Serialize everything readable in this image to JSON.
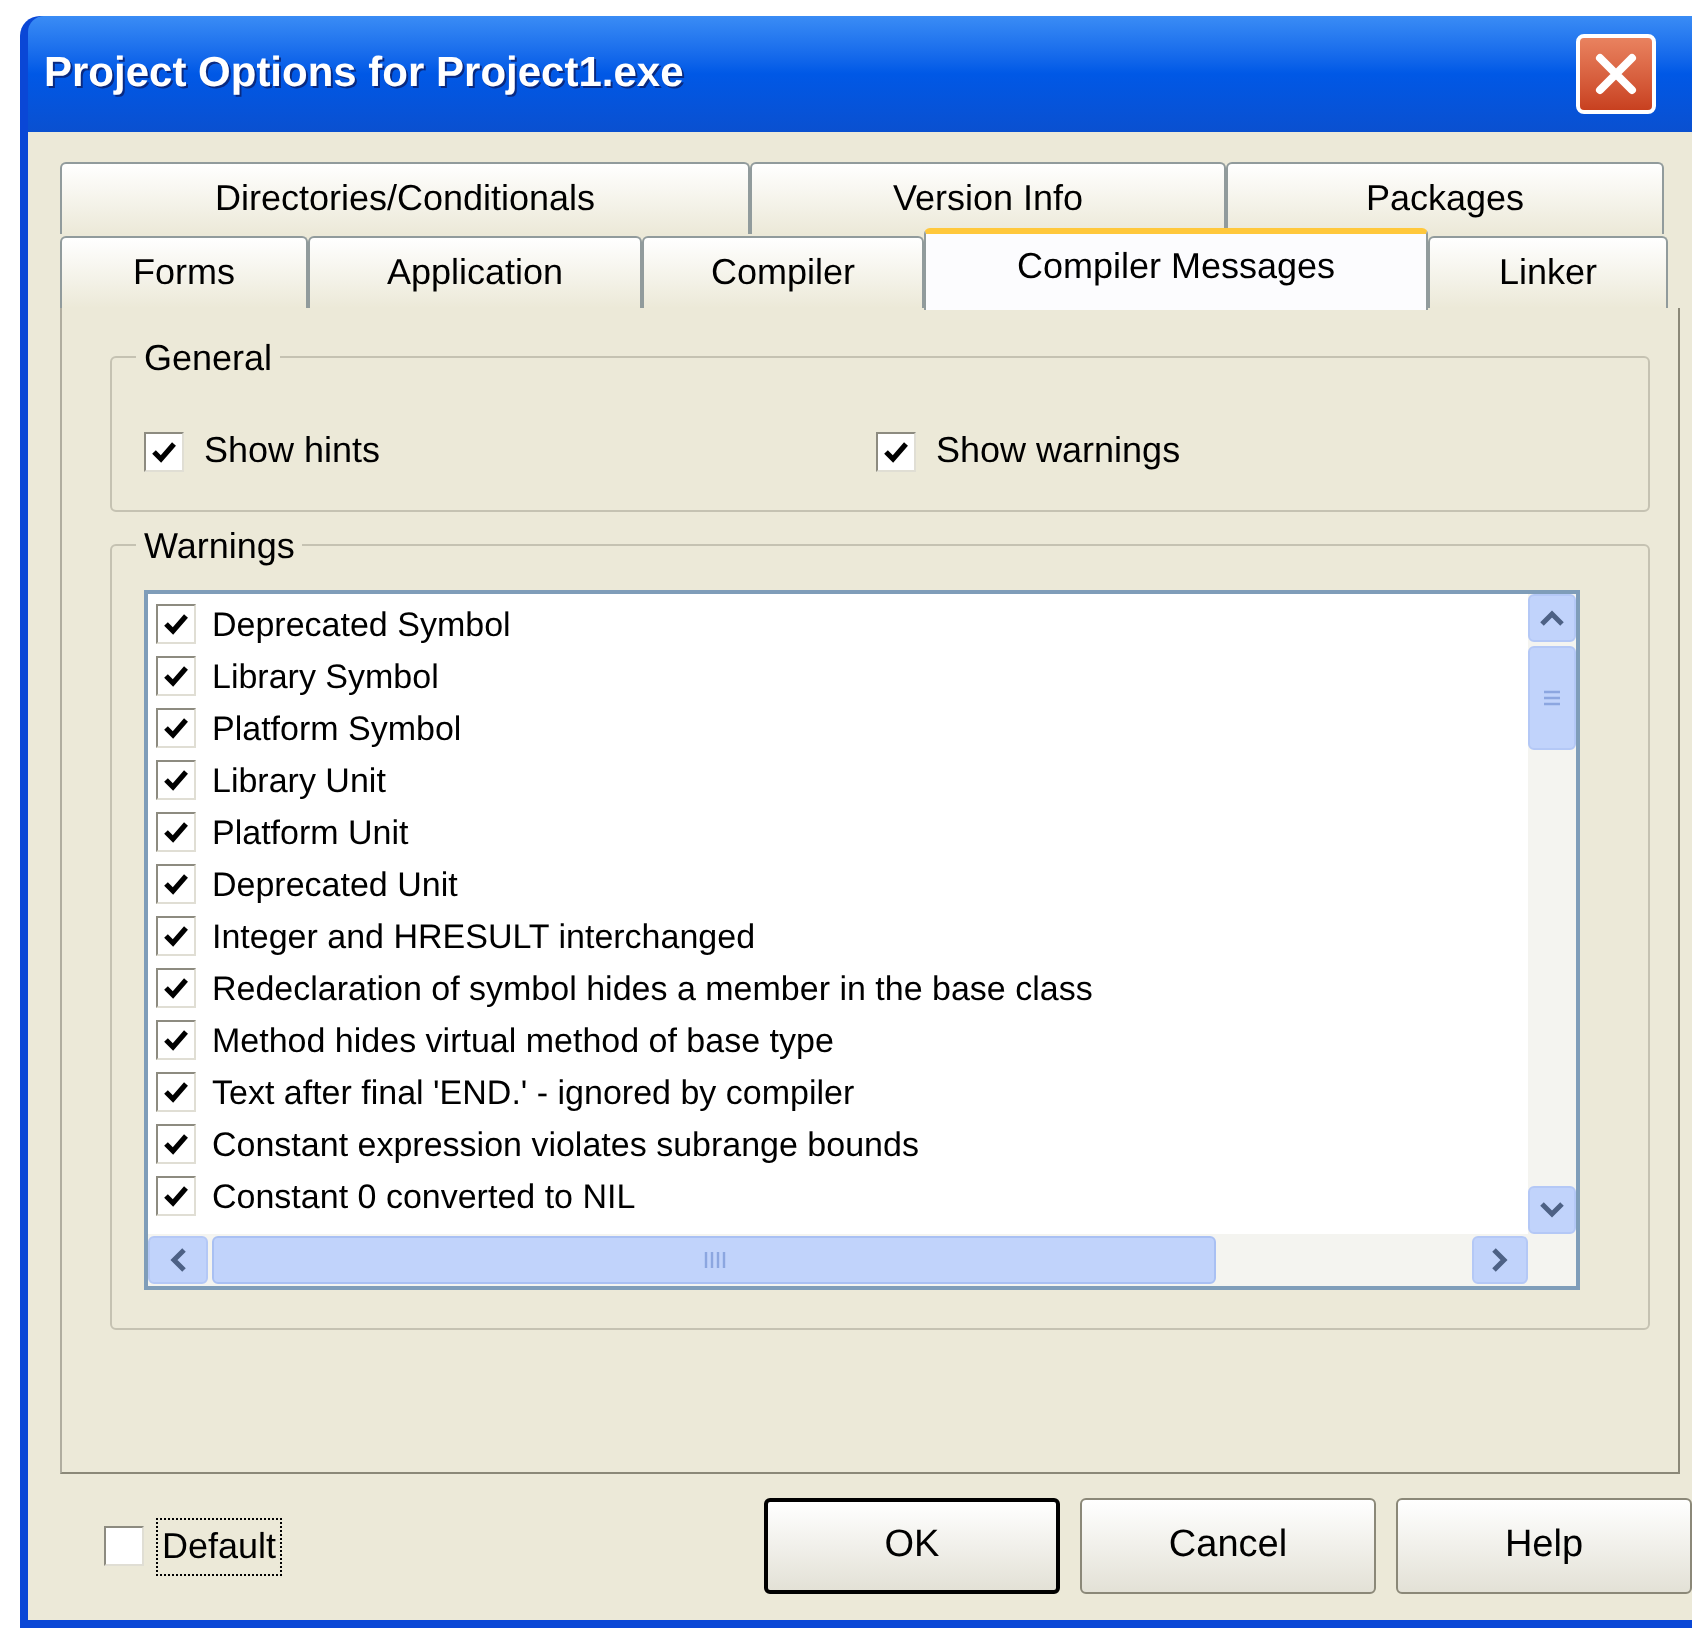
{
  "window": {
    "title": "Project Options for Project1.exe"
  },
  "tab_rows": [
    {
      "tabs": [
        {
          "label": "Directories/Conditionals",
          "selected": false
        },
        {
          "label": "Version Info",
          "selected": false
        },
        {
          "label": "Packages",
          "selected": false
        }
      ]
    },
    {
      "tabs": [
        {
          "label": "Forms",
          "selected": false
        },
        {
          "label": "Application",
          "selected": false
        },
        {
          "label": "Compiler",
          "selected": false
        },
        {
          "label": "Compiler Messages",
          "selected": true
        },
        {
          "label": "Linker",
          "selected": false
        }
      ]
    }
  ],
  "general": {
    "title": "General",
    "checkboxes": [
      {
        "label": "Show hints",
        "checked": true
      },
      {
        "label": "Show warnings",
        "checked": true
      }
    ]
  },
  "warnings": {
    "title": "Warnings",
    "items": [
      {
        "label": "Deprecated Symbol",
        "checked": true
      },
      {
        "label": "Library Symbol",
        "checked": true
      },
      {
        "label": "Platform Symbol",
        "checked": true
      },
      {
        "label": "Library Unit",
        "checked": true
      },
      {
        "label": "Platform Unit",
        "checked": true
      },
      {
        "label": "Deprecated Unit",
        "checked": true
      },
      {
        "label": "Integer and HRESULT interchanged",
        "checked": true
      },
      {
        "label": "Redeclaration of symbol hides a member in the base class",
        "checked": true
      },
      {
        "label": "Method hides virtual method of base type",
        "checked": true
      },
      {
        "label": "Text after final 'END.' - ignored by compiler",
        "checked": true
      },
      {
        "label": "Constant expression violates subrange bounds",
        "checked": true
      },
      {
        "label": "Constant 0 converted to NIL",
        "checked": true
      }
    ]
  },
  "default_option": {
    "label": "Default",
    "checked": false
  },
  "buttons": [
    {
      "label": "OK",
      "default": true
    },
    {
      "label": "Cancel",
      "default": false
    },
    {
      "label": "Help",
      "default": false
    }
  ]
}
